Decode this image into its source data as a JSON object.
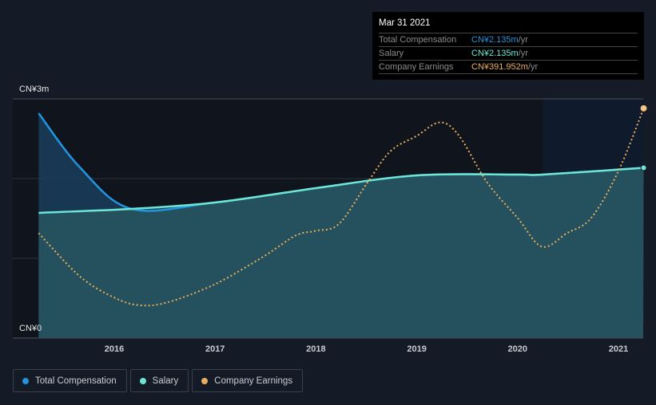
{
  "tooltip": {
    "date": "Mar 31 2021",
    "rows": [
      {
        "label": "Total Compensation",
        "value": "CN¥2.135m",
        "unit": " /yr",
        "color": "#2394df"
      },
      {
        "label": "Salary",
        "value": "CN¥2.135m",
        "unit": " /yr",
        "color": "#6ee6d6"
      },
      {
        "label": "Company Earnings",
        "value": "CN¥391.952m",
        "unit": " /yr",
        "color": "#e8b05a"
      }
    ]
  },
  "legend": [
    {
      "label": "Total Compensation",
      "color": "#2394df"
    },
    {
      "label": "Salary",
      "color": "#6ee6d6"
    },
    {
      "label": "Company Earnings",
      "color": "#e8b05a"
    }
  ],
  "chart_data": {
    "type": "line",
    "ylabel_top": "CN¥3m",
    "ylabel_bottom": "CN¥0",
    "ylim": [
      0,
      3
    ],
    "xlim": [
      2015.25,
      2021.25
    ],
    "xticks": [
      "2016",
      "2017",
      "2018",
      "2019",
      "2020",
      "2021"
    ],
    "series": [
      {
        "name": "Total Compensation",
        "unit": "CN¥m",
        "points": [
          [
            2015.25,
            2.82
          ],
          [
            2015.66,
            2.14
          ],
          [
            2016.17,
            1.62
          ],
          [
            2017,
            1.7
          ],
          [
            2018,
            1.88
          ],
          [
            2019,
            2.04
          ],
          [
            2020,
            2.05
          ],
          [
            2020.25,
            2.05
          ],
          [
            2021.25,
            2.135
          ]
        ]
      },
      {
        "name": "Salary",
        "unit": "CN¥m",
        "points": [
          [
            2015.25,
            1.57
          ],
          [
            2016.17,
            1.62
          ],
          [
            2017,
            1.7
          ],
          [
            2018,
            1.88
          ],
          [
            2019,
            2.04
          ],
          [
            2020,
            2.05
          ],
          [
            2020.25,
            2.05
          ],
          [
            2021.25,
            2.135
          ]
        ]
      },
      {
        "name": "Company Earnings",
        "unit": "CN¥m",
        "secondary_axis_max": 400,
        "points": [
          [
            2015.25,
            179
          ],
          [
            2015.66,
            105
          ],
          [
            2016,
            69
          ],
          [
            2016.25,
            56
          ],
          [
            2016.53,
            61
          ],
          [
            2017,
            92
          ],
          [
            2017.48,
            139
          ],
          [
            2017.8,
            175
          ],
          [
            2018,
            183
          ],
          [
            2018.23,
            195
          ],
          [
            2018.51,
            265
          ],
          [
            2018.74,
            319
          ],
          [
            2019,
            345
          ],
          [
            2019.23,
            368
          ],
          [
            2019.42,
            345
          ],
          [
            2019.7,
            265
          ],
          [
            2020,
            205
          ],
          [
            2020.24,
            156
          ],
          [
            2020.49,
            179
          ],
          [
            2020.73,
            205
          ],
          [
            2021,
            285
          ],
          [
            2021.25,
            392
          ]
        ]
      }
    ],
    "highlight_range": [
      2020.25,
      2021.25
    ]
  }
}
